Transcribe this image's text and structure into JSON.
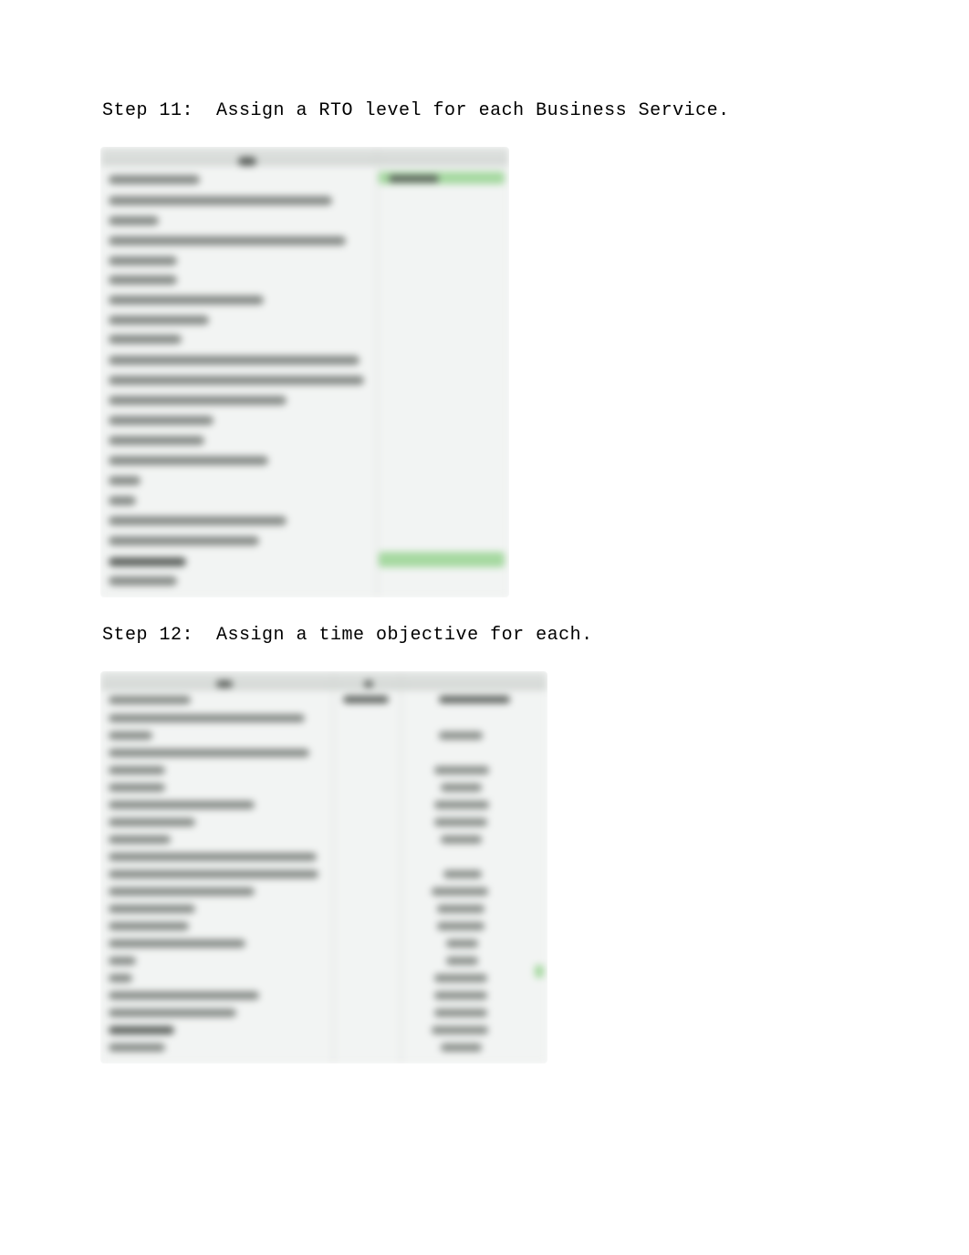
{
  "steps": {
    "step11": "Step 11:  Assign a RTO level for each Business Service.",
    "step12": "Step 12:  Assign a time objective for each."
  }
}
